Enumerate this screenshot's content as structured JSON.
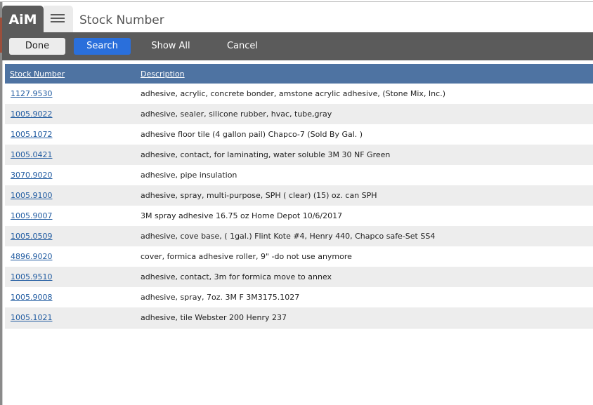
{
  "header": {
    "logo": "AiM",
    "menu_icon": "hamburger-menu-icon",
    "title": "Stock Number"
  },
  "toolbar": {
    "done_label": "Done",
    "search_label": "Search",
    "show_all_label": "Show All",
    "cancel_label": "Cancel"
  },
  "colors": {
    "toolbar_bg": "#5b5b5b",
    "search_button": "#2a6fdb",
    "table_header_bg": "#4e73a2",
    "link": "#1f5aa0",
    "row_alt": "#ededed"
  },
  "table": {
    "columns": [
      "Stock Number",
      "Description"
    ],
    "rows": [
      {
        "stock_number": "1127.9530",
        "description": "adhesive, acrylic, concrete bonder, amstone acrylic adhesive, (Stone Mix, Inc.)"
      },
      {
        "stock_number": "1005.9022",
        "description": "adhesive, sealer, silicone rubber, hvac, tube,gray"
      },
      {
        "stock_number": "1005.1072",
        "description": "adhesive floor tile (4 gallon pail) Chapco-7 (Sold By Gal. )"
      },
      {
        "stock_number": "1005.0421",
        "description": "adhesive, contact, for laminating, water soluble 3M 30 NF Green"
      },
      {
        "stock_number": "3070.9020",
        "description": "adhesive, pipe insulation"
      },
      {
        "stock_number": "1005.9100",
        "description": "adhesive, spray, multi-purpose, SPH ( clear) (15) oz. can SPH"
      },
      {
        "stock_number": "1005.9007",
        "description": "3M spray adhesive 16.75 oz Home Depot 10/6/2017"
      },
      {
        "stock_number": "1005.0509",
        "description": "adhesive, cove base, ( 1gal.) Flint Kote #4, Henry 440, Chapco safe-Set SS4"
      },
      {
        "stock_number": "4896.9020",
        "description": "cover, formica adhesive roller, 9\" -do not use anymore"
      },
      {
        "stock_number": "1005.9510",
        "description": "adhesive, contact, 3m for formica move to annex"
      },
      {
        "stock_number": "1005.9008",
        "description": "adhesive, spray, 7oz. 3M F 3M3175.1027"
      },
      {
        "stock_number": "1005.1021",
        "description": "adhesive, tile Webster 200 Henry 237"
      }
    ]
  }
}
